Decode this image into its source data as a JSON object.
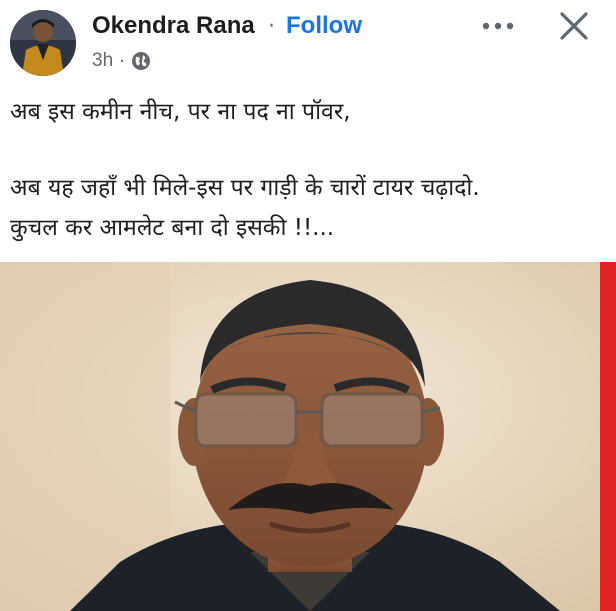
{
  "post": {
    "author": "Okendra Rana",
    "separator": "·",
    "follow_label": "Follow",
    "timestamp": "3h",
    "meta_dot": "·",
    "audience_icon": "globe-icon",
    "more_icon": "more-options-icon",
    "close_icon": "close-icon",
    "text_line_1": "अब इस कमीन नीच, पर ना पद ना पॉवर,",
    "text_line_2": "अब यह जहाँ भी मिले-इस पर गाड़ी के चारों टायर चढ़ादो.",
    "text_line_3": "कुचल कर आमलेट बना दो इसकी !!..."
  },
  "colors": {
    "link": "#1b74e4",
    "meta": "#65676b",
    "accent_bar": "#e02323"
  }
}
